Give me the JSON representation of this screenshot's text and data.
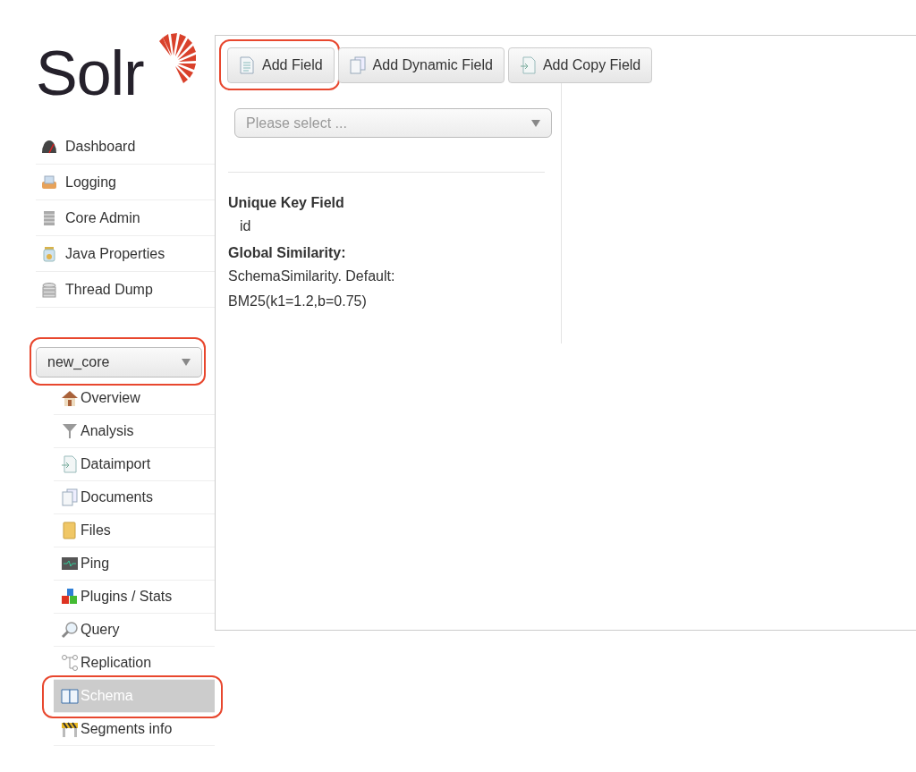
{
  "logo": {
    "text": "Solr"
  },
  "nav": [
    {
      "label": "Dashboard"
    },
    {
      "label": "Logging"
    },
    {
      "label": "Core Admin"
    },
    {
      "label": "Java Properties"
    },
    {
      "label": "Thread Dump"
    }
  ],
  "core_selector": {
    "value": "new_core",
    "highlighted": true
  },
  "core_menu": [
    {
      "label": "Overview",
      "selected": false,
      "highlighted": false
    },
    {
      "label": "Analysis",
      "selected": false,
      "highlighted": false
    },
    {
      "label": "Dataimport",
      "selected": false,
      "highlighted": false
    },
    {
      "label": "Documents",
      "selected": false,
      "highlighted": false
    },
    {
      "label": "Files",
      "selected": false,
      "highlighted": false
    },
    {
      "label": "Ping",
      "selected": false,
      "highlighted": false
    },
    {
      "label": "Plugins / Stats",
      "selected": false,
      "highlighted": false
    },
    {
      "label": "Query",
      "selected": false,
      "highlighted": false
    },
    {
      "label": "Replication",
      "selected": false,
      "highlighted": false
    },
    {
      "label": "Schema",
      "selected": true,
      "highlighted": true
    },
    {
      "label": "Segments info",
      "selected": false,
      "highlighted": false
    }
  ],
  "toolbar": [
    {
      "label": "Add Field",
      "highlighted": true
    },
    {
      "label": "Add Dynamic Field",
      "highlighted": false
    },
    {
      "label": "Add Copy Field",
      "highlighted": false
    }
  ],
  "field_select": {
    "placeholder": "Please select ..."
  },
  "unique_key": {
    "heading": "Unique Key Field",
    "value": "id"
  },
  "similarity": {
    "heading": "Global Similarity:",
    "lines": [
      "SchemaSimilarity. Default:",
      "BM25(k1=1.2,b=0.75)"
    ]
  }
}
